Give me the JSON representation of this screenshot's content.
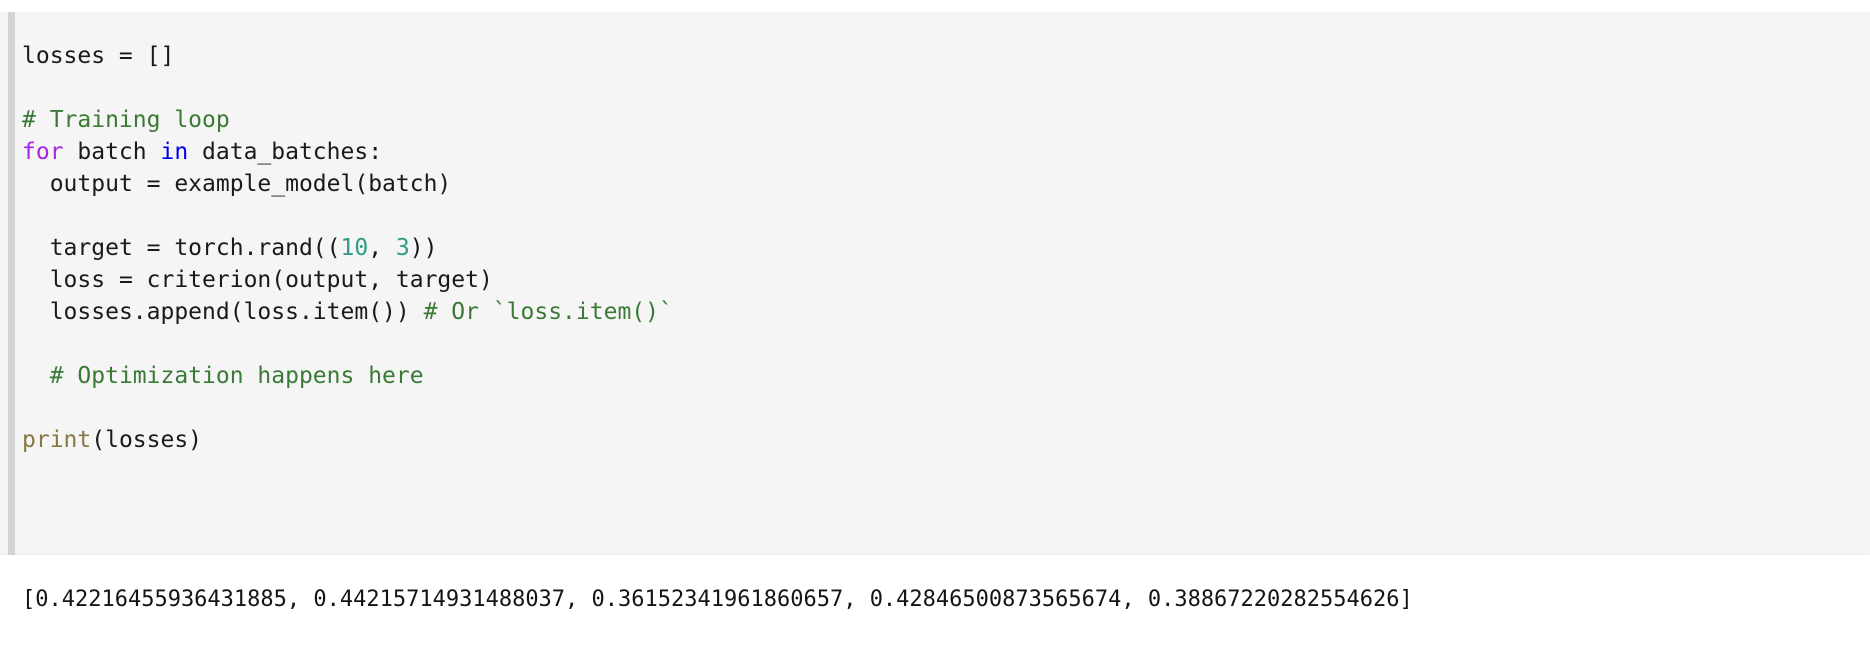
{
  "cell": {
    "type": "code",
    "language": "python",
    "colors": {
      "code_background": "#f5f5f5",
      "output_background": "#ffffff",
      "gutter_bar": "#d4d4d4",
      "comment": "#3a7a35",
      "keyword": "#a626e0",
      "operator_keyword": "#0000ef",
      "number": "#2e9c87",
      "builtin": "#8a7640",
      "plain_text": "#1a1a1a"
    }
  },
  "code": {
    "lines": [
      {
        "id": "line-1",
        "indent": "",
        "tokens": [
          {
            "t": "plain",
            "v": "losses = []"
          }
        ]
      },
      {
        "id": "line-2",
        "indent": "",
        "tokens": []
      },
      {
        "id": "line-3",
        "indent": "",
        "tokens": [
          {
            "t": "comment",
            "v": "# Training loop"
          }
        ]
      },
      {
        "id": "line-4",
        "indent": "",
        "tokens": [
          {
            "t": "keyword",
            "v": "for"
          },
          {
            "t": "plain",
            "v": " batch "
          },
          {
            "t": "operator",
            "v": "in"
          },
          {
            "t": "plain",
            "v": " data_batches:"
          }
        ]
      },
      {
        "id": "line-5",
        "indent": "  ",
        "tokens": [
          {
            "t": "plain",
            "v": "output = example_model(batch)"
          }
        ]
      },
      {
        "id": "line-6",
        "indent": "",
        "tokens": []
      },
      {
        "id": "line-7",
        "indent": "  ",
        "tokens": [
          {
            "t": "plain",
            "v": "target = torch.rand(("
          },
          {
            "t": "number",
            "v": "10"
          },
          {
            "t": "plain",
            "v": ", "
          },
          {
            "t": "number",
            "v": "3"
          },
          {
            "t": "plain",
            "v": "))"
          }
        ]
      },
      {
        "id": "line-8",
        "indent": "  ",
        "tokens": [
          {
            "t": "plain",
            "v": "loss = criterion(output, target)"
          }
        ]
      },
      {
        "id": "line-9",
        "indent": "  ",
        "tokens": [
          {
            "t": "plain",
            "v": "losses.append(loss.item()) "
          },
          {
            "t": "comment",
            "v": "# Or `loss.item()`"
          }
        ]
      },
      {
        "id": "line-10",
        "indent": "",
        "tokens": []
      },
      {
        "id": "line-11",
        "indent": "  ",
        "tokens": [
          {
            "t": "comment",
            "v": "# Optimization happens here"
          }
        ]
      },
      {
        "id": "line-12",
        "indent": "",
        "tokens": []
      },
      {
        "id": "line-13",
        "indent": "",
        "tokens": [
          {
            "t": "builtin",
            "v": "print"
          },
          {
            "t": "plain",
            "v": "(losses)"
          }
        ]
      }
    ]
  },
  "output": {
    "stream": "stdout",
    "text": "[0.42216455936431885, 0.44215714931488037, 0.36152341961860657, 0.42846500873565674, 0.38867220282554626]",
    "values": [
      0.42216455936431885,
      0.44215714931488037,
      0.36152341961860657,
      0.42846500873565674,
      0.38867220282554626
    ]
  }
}
